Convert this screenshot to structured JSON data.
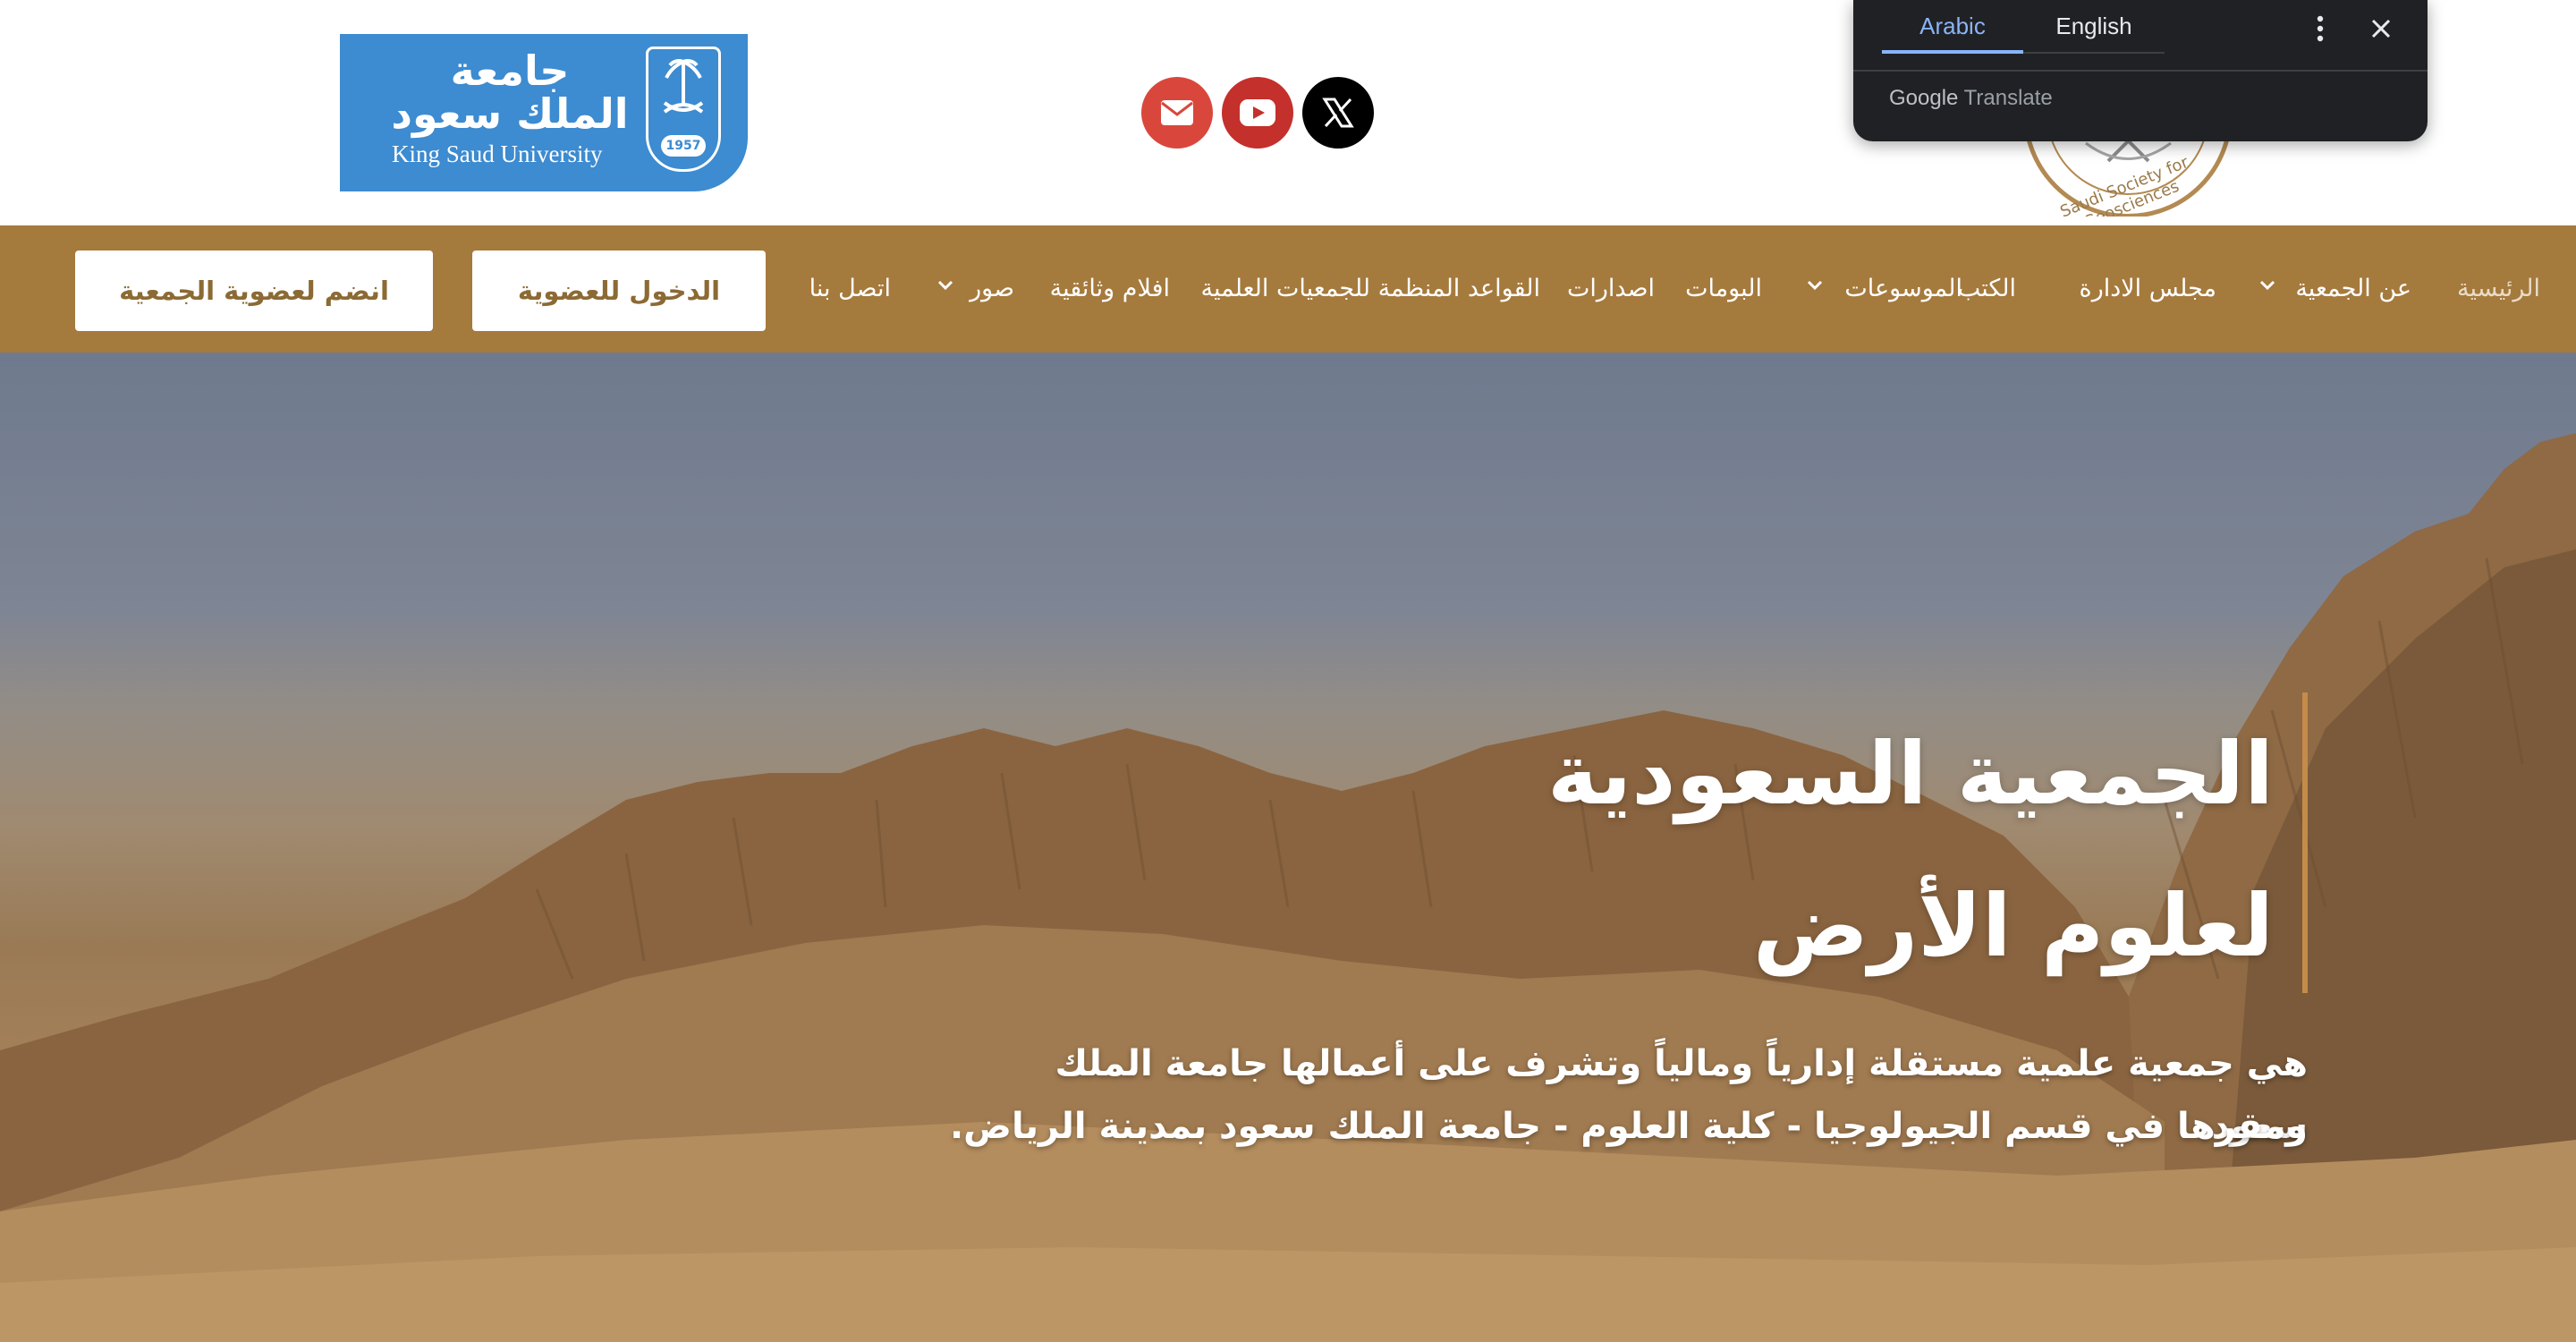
{
  "header": {
    "ksu_logo": {
      "arabic_line1": "جامعة",
      "arabic_line2": "الملك سعود",
      "english": "King Saud University",
      "year": "1957"
    },
    "social": [
      {
        "name": "email",
        "icon": "envelope-icon",
        "color": "#d9473c"
      },
      {
        "name": "youtube",
        "icon": "youtube-icon",
        "color": "#c4302b"
      },
      {
        "name": "x",
        "icon": "x-logo-icon",
        "color": "#000000"
      }
    ],
    "society_seal_text": "Saudi Society for Geosciences"
  },
  "translate_popup": {
    "tabs": [
      "Arabic",
      "English"
    ],
    "active_tab": "Arabic",
    "brand_google": "Google",
    "brand_translate": "Translate"
  },
  "nav": {
    "items": [
      {
        "label": "الرئيسية",
        "dropdown": false
      },
      {
        "label": "عن الجمعية",
        "dropdown": true
      },
      {
        "label": "مجلس الادارة",
        "dropdown": false
      },
      {
        "label": "الكتب",
        "dropdown": false
      },
      {
        "label": "الموسوعات",
        "dropdown": true
      },
      {
        "label": "البومات",
        "dropdown": false
      },
      {
        "label": "اصدارات",
        "dropdown": false
      },
      {
        "label": "القواعد المنظمة للجمعيات العلمية",
        "dropdown": false
      },
      {
        "label": "افلام وثائقية",
        "dropdown": false
      },
      {
        "label": "صور",
        "dropdown": true
      },
      {
        "label": "اتصل بنا",
        "dropdown": false
      }
    ],
    "login_button": "الدخول للعضوية",
    "join_button": "انضم لعضوية الجمعية"
  },
  "hero": {
    "title_line1": "الجمعية السعودية",
    "title_line2": "لعلوم الأرض",
    "desc_line1": "هي جمعية علمية مستقلة إدارياً ومالياً وتشرف على أعمالها  جامعة الملك سعود،",
    "desc_line2": "ومقرها في قسم الجيولوجيا - كلية العلوم - جامعة الملك سعود بمدينة الرياض."
  },
  "colors": {
    "nav_bg": "#a57a3d",
    "button_text": "#8b6a34",
    "accent": "#c48b4a",
    "ksu_blue": "#3d8bd0",
    "translate_active": "#8ab4f8"
  }
}
